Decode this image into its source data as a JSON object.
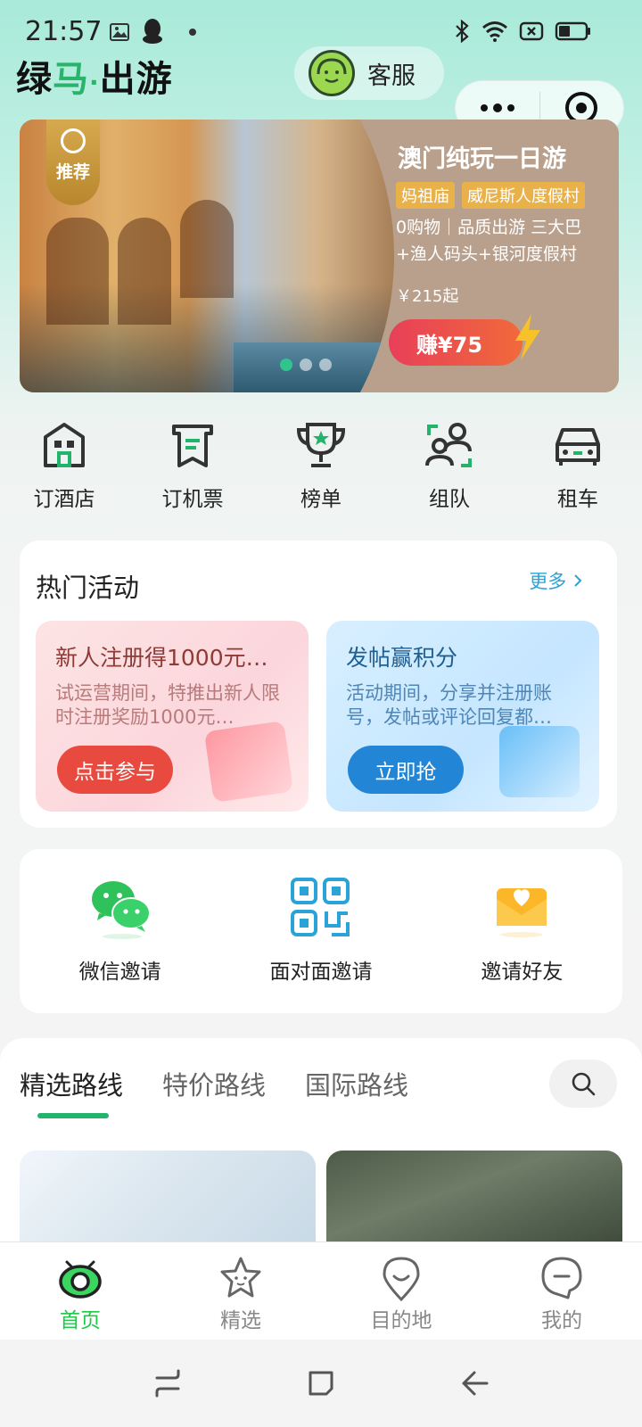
{
  "status_bar": {
    "time": "21:57",
    "icons": [
      "image-icon",
      "qq-icon",
      "bluetooth-icon",
      "wifi-icon",
      "sim-icon",
      "battery-icon"
    ]
  },
  "header": {
    "brand_part1": "绿",
    "brand_part2": "马",
    "brand_dot": "·",
    "brand_part3": "出游",
    "service_label": "客服"
  },
  "capsule": {
    "more_icon": "more-dots-icon",
    "close_icon": "close-target-icon"
  },
  "banner": {
    "badge": "推荐",
    "title": "澳门纯玩一日游",
    "tags": [
      "妈祖庙",
      "威尼斯人度假村"
    ],
    "desc_line1": "0购物｜品质出游 三大巴",
    "desc_line2": "+渔人码头+银河度假村",
    "price": "￥215起",
    "earn": "赚¥75",
    "slide_count": 3,
    "active_slide": 0
  },
  "quick_nav": [
    {
      "label": "订酒店",
      "icon": "hotel-icon"
    },
    {
      "label": "订机票",
      "icon": "ticket-icon"
    },
    {
      "label": "榜单",
      "icon": "trophy-icon"
    },
    {
      "label": "组队",
      "icon": "team-icon"
    },
    {
      "label": "租车",
      "icon": "car-icon"
    }
  ],
  "hot_activities": {
    "title": "热门活动",
    "more": "更多",
    "items": [
      {
        "title": "新人注册得1000元…",
        "desc": "试运营期间，特推出新人限时注册奖励1000元…",
        "button": "点击参与"
      },
      {
        "title": "发帖赢积分",
        "desc": "活动期间，分享并注册账号，发帖或评论回复都…",
        "button": "立即抢"
      }
    ]
  },
  "invite": [
    {
      "label": "微信邀请",
      "icon": "wechat-icon"
    },
    {
      "label": "面对面邀请",
      "icon": "qrcode-icon"
    },
    {
      "label": "邀请好友",
      "icon": "mail-heart-icon"
    }
  ],
  "routes": {
    "tabs": [
      "精选路线",
      "特价路线",
      "国际路线"
    ],
    "active_tab": 0
  },
  "tab_bar": [
    {
      "label": "首页",
      "icon": "home-eye-icon"
    },
    {
      "label": "精选",
      "icon": "star-icon"
    },
    {
      "label": "目的地",
      "icon": "destination-icon"
    },
    {
      "label": "我的",
      "icon": "profile-icon"
    }
  ],
  "colors": {
    "accent_green": "#23b36d",
    "tab_active": "#22c84a",
    "link_blue": "#2aa4d8"
  }
}
